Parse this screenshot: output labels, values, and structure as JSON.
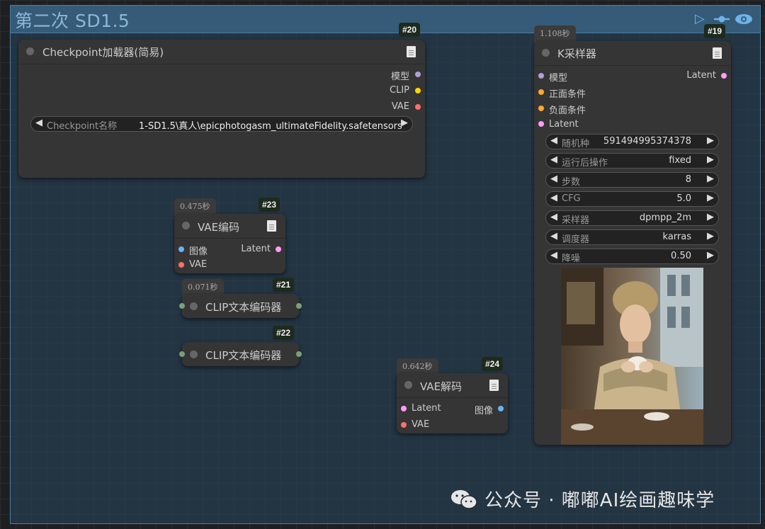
{
  "group": {
    "title": "第二次 SD1.5"
  },
  "colors": {
    "model": "#b39ddb",
    "clip": "#ffd500",
    "vae": "#ff6e6e",
    "latent": "#ff9cf9",
    "image": "#64b5f6",
    "conditioning": "#ffa931"
  },
  "nodes": {
    "checkpoint": {
      "id": "#20",
      "title": "Checkpoint加载器(简易)",
      "outputs": [
        "模型",
        "CLIP",
        "VAE"
      ],
      "widget": {
        "label": "Checkpoint名称",
        "value": "1-SD1.5\\真人\\epicphotogasm_ultimateFidelity.safetensors"
      }
    },
    "vae_encode": {
      "id": "#23",
      "time": "0.475秒",
      "title": "VAE编码",
      "inputs": [
        "图像",
        "VAE"
      ],
      "outputs": [
        "Latent"
      ]
    },
    "clip21": {
      "id": "#21",
      "time": "0.071秒",
      "title": "CLIP文本编码器"
    },
    "clip22": {
      "id": "#22",
      "title": "CLIP文本编码器"
    },
    "vae_decode": {
      "id": "#24",
      "time": "0.642秒",
      "title": "VAE解码",
      "inputs": [
        "Latent",
        "VAE"
      ],
      "outputs": [
        "图像"
      ]
    },
    "ksampler": {
      "id": "#19",
      "time": "1.108秒",
      "title": "K采样器",
      "inputs": [
        "模型",
        "正面条件",
        "负面条件",
        "Latent"
      ],
      "outputs": [
        "Latent"
      ],
      "widgets": [
        {
          "label": "随机种",
          "value": "591494995374378"
        },
        {
          "label": "运行后操作",
          "value": "fixed"
        },
        {
          "label": "步数",
          "value": "8"
        },
        {
          "label": "CFG",
          "value": "5.0"
        },
        {
          "label": "采样器",
          "value": "dpmpp_2m"
        },
        {
          "label": "调度器",
          "value": "karras"
        },
        {
          "label": "降噪",
          "value": "0.50"
        }
      ]
    }
  },
  "watermark": "公众号 · 嘟嘟AI绘画趣味学"
}
